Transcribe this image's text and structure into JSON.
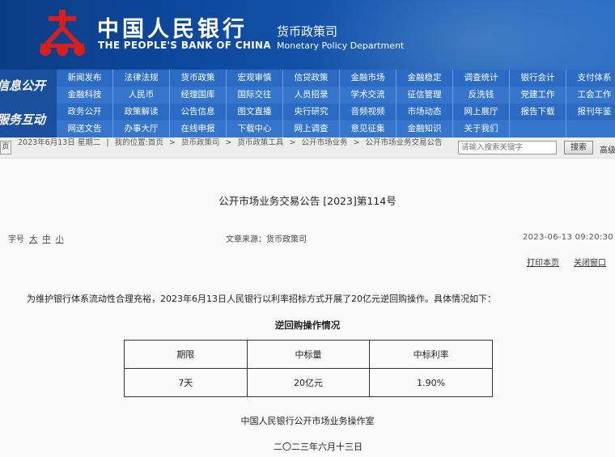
{
  "header": {
    "title_cn": "中国人民银行",
    "title_en": "THE PEOPLE'S BANK OF CHINA",
    "dept_cn": "货币政策司",
    "dept_en": "Monetary Policy Department",
    "logo_icon": "pboc-emblem-icon",
    "colors": {
      "banner": "#0e4aa0",
      "emblem": "#d7201c"
    }
  },
  "nav": {
    "side_labels": [
      "信息公开",
      "服务互动"
    ],
    "rows": [
      [
        "新闻发布",
        "法律法规",
        "货币政策",
        "宏观审慎",
        "信贷政策",
        "金融市场",
        "金融稳定",
        "调查统计",
        "银行会计",
        "支付体系"
      ],
      [
        "金融科技",
        "人民币",
        "经理国库",
        "国际交往",
        "人员招录",
        "学术交流",
        "征信管理",
        "反洗钱",
        "党建工作",
        "工会工作"
      ],
      [
        "政务公开",
        "政策解读",
        "公告信息",
        "图文直播",
        "央行研究",
        "音频视频",
        "市场动态",
        "网上展厅",
        "报告下载",
        "报刊年鉴"
      ],
      [
        "网送文告",
        "办事大厅",
        "在线申报",
        "下载中心",
        "网上调查",
        "意见征集",
        "金融知识",
        "关于我们",
        "",
        ""
      ]
    ]
  },
  "breadcrumb": {
    "home_label": "页",
    "date": "2023年6月13日",
    "weekday": "星期二",
    "location_label": "我的位置:",
    "path": [
      "首页",
      "货币政策司",
      "货币政策工具",
      "公开市场业务",
      "公开市场业务交易公告"
    ],
    "search_placeholder": "请输入搜索关键字",
    "search_button": "搜索",
    "advanced_search": "高级"
  },
  "article": {
    "title": "公开市场业务交易公告 [2023]第114号",
    "font_label": "字号",
    "font_sizes": [
      "大",
      "中",
      "小"
    ],
    "source": "文章来源：货币政策司",
    "datetime": "2023-06-13 09:20:30",
    "print_label": "打印本页",
    "close_label": "关闭窗口",
    "paragraph": "为维护银行体系流动性合理充裕，2023年6月13日人民银行以利率招标方式开展了20亿元逆回购操作。具体情况如下：",
    "table_title": "逆回购操作情况",
    "table": {
      "headers": [
        "期限",
        "中标量",
        "中标利率"
      ],
      "rows": [
        [
          "7天",
          "20亿元",
          "1.90%"
        ]
      ]
    },
    "signature": "中国人民银行公开市场业务操作室",
    "sign_date": "二〇二三年六月十三日"
  }
}
